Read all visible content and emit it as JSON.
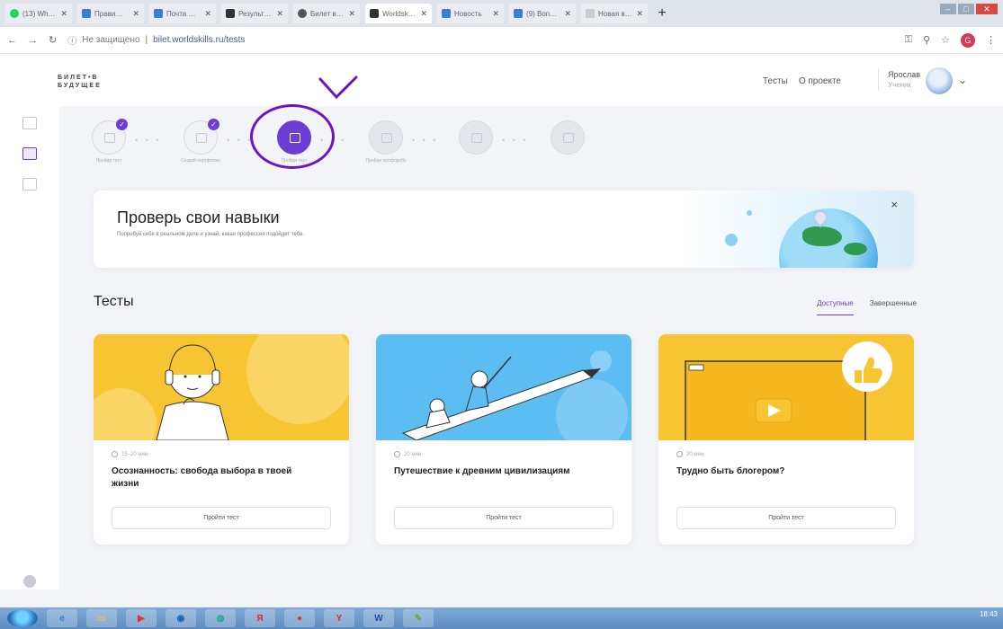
{
  "browser": {
    "tabs": [
      {
        "label": "(13) Wha…",
        "color": "#25d366",
        "active": false
      },
      {
        "label": "Прави…",
        "color": "#3b7dd8",
        "active": false
      },
      {
        "label": "Почта M…",
        "color": "#3b7dd8",
        "active": false
      },
      {
        "label": "Результ…",
        "color": "#333333",
        "active": false
      },
      {
        "label": "Билет в б…",
        "color": "#555555",
        "active": false
      },
      {
        "label": "Worldsk…",
        "color": "#333333",
        "active": true
      },
      {
        "label": "Новость",
        "color": "#3b7dd8",
        "active": false
      },
      {
        "label": "(9) Вопро…",
        "color": "#3b7dd8",
        "active": false
      },
      {
        "label": "Новая вкладк…",
        "color": "#cccccc",
        "active": false
      }
    ],
    "new_tab": "+",
    "address": {
      "security": "Не защищено",
      "url": "bilet.worldskills.ru/tests"
    },
    "profile_initial": "G"
  },
  "header": {
    "logo_line1": "БИЛЕТ•В",
    "logo_line2": "БУДУЩЕЕ",
    "nav": [
      "Тесты",
      "О проекте"
    ],
    "user_name": "Ярослав",
    "user_role": "Ученик",
    "chevron": "⌄"
  },
  "steps": {
    "labels": [
      "Пройди тест",
      "Создай портфолио",
      "Пройди тест",
      "Пройди профпробу",
      "",
      ""
    ],
    "checkmark": "✓"
  },
  "banner": {
    "title": "Проверь свои навыки",
    "subtitle": "Попробуй себя в реальном деле и узнай, какая профессия подойдет тебе.",
    "close": "×"
  },
  "tests": {
    "title": "Тесты",
    "tabs": [
      "Доступные",
      "Завершенные"
    ],
    "cards": [
      {
        "meta": "15–20 мин",
        "title": "Осознанность: свобода выбора в твоей жизни",
        "button": "Пройти тест",
        "bg": "#f7c531"
      },
      {
        "meta": "20 мин",
        "title": "Путешествие к древним цивилизациям",
        "button": "Пройти тест",
        "bg": "#5bbdf1"
      },
      {
        "meta": "20 мин",
        "title": "Трудно быть блогером?",
        "button": "Пройти тест",
        "bg": "#f7c531"
      }
    ]
  },
  "taskbar": {
    "apps": [
      "",
      "",
      "",
      "",
      "",
      "Я",
      "",
      "Y",
      "W",
      ""
    ],
    "time": "18:43"
  },
  "colors": {
    "accent": "#6c3ed6",
    "annotation": "#6b14c9",
    "yellow": "#f7c531",
    "blue": "#5bbdf1"
  }
}
